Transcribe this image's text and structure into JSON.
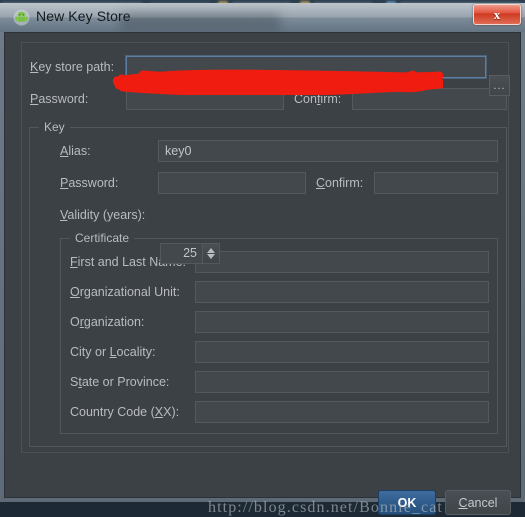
{
  "window": {
    "title": "New Key Store",
    "app_icon": "android-robot-icon",
    "close_label": "x"
  },
  "keystore": {
    "path_label": "Key store path:",
    "path_label_mnemonic": "K",
    "path_value": "",
    "path_redacted": true,
    "browse_label": "...",
    "password_label": "Password:",
    "password_label_mnemonic": "P",
    "password_value": "",
    "confirm_label": "Confirm:",
    "confirm_label_mnemonic": "f",
    "confirm_value": ""
  },
  "key_group": {
    "title": "Key",
    "alias_label": "Alias:",
    "alias_label_mnemonic": "A",
    "alias_value": "key0",
    "password_label": "Password:",
    "password_label_mnemonic": "P",
    "password_value": "",
    "confirm_label": "Confirm:",
    "confirm_label_mnemonic": "C",
    "confirm_value": "",
    "validity_label": "Validity (years):",
    "validity_label_mnemonic": "V",
    "validity_value": "25"
  },
  "certificate_group": {
    "title": "Certificate",
    "fields": [
      {
        "label": "First and Last Name:",
        "mnemonic": "F",
        "value": ""
      },
      {
        "label": "Organizational Unit:",
        "mnemonic": "O",
        "value": ""
      },
      {
        "label": "Organization:",
        "mnemonic": "r",
        "value": ""
      },
      {
        "label": "City or Locality:",
        "mnemonic": "L",
        "value": ""
      },
      {
        "label": "State or Province:",
        "mnemonic": "t",
        "value": ""
      },
      {
        "label": "Country Code (XX):",
        "mnemonic": "X",
        "value": ""
      }
    ]
  },
  "footer": {
    "ok_label": "OK",
    "cancel_label": "Cancel",
    "cancel_mnemonic": "C"
  },
  "watermark": {
    "text": "http://blog.csdn.net/Bonnie_cat"
  },
  "colors": {
    "dialog_bg": "#3c4146",
    "field_bg": "#43484d",
    "field_border": "#55595e",
    "label_text": "#b9bcbf",
    "focus_border": "#5a7fa5",
    "ok_blue": "#2f5c8c",
    "close_red": "#cf3a22",
    "redaction_red": "#ef1c0f"
  }
}
